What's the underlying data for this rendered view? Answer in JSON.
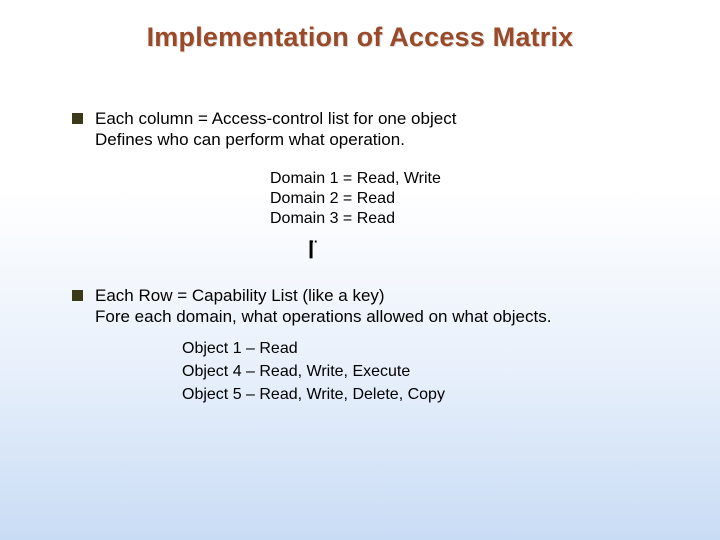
{
  "title": "Implementation of Access Matrix",
  "section1": {
    "heading": "Each column = Access-control list for one object",
    "sub": "Defines who can perform what operation.",
    "domains": {
      "d1": "Domain 1 = Read, Write",
      "d2": "Domain 2 = Read",
      "d3": "Domain 3 = Read"
    }
  },
  "mid_glyph": "❙̈",
  "section2": {
    "heading": "Each Row = Capability List (like a key)",
    "sub": "Fore each domain, what operations allowed on what objects.",
    "objects": {
      "o1": "Object 1 – Read",
      "o4": "Object 4 – Read, Write, Execute",
      "o5": "Object 5 – Read, Write, Delete, Copy"
    }
  }
}
